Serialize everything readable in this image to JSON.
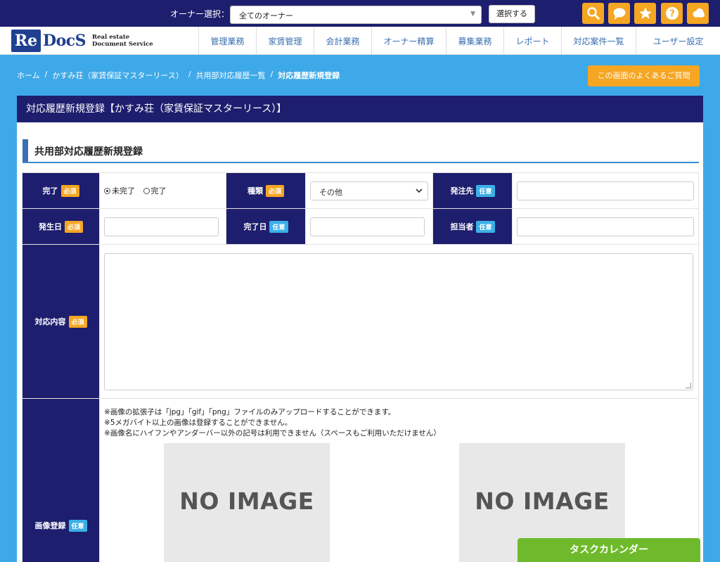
{
  "topbar": {
    "owner_label": "オーナー選択：",
    "owner_value": "全てのオーナー",
    "select_button": "選択する"
  },
  "logo": {
    "re": "Re",
    "docs": "DocS",
    "sub1": "Real estate",
    "sub2": "Document Service"
  },
  "nav": [
    "管理業務",
    "家賃管理",
    "会計業務",
    "オーナー精算",
    "募集業務",
    "レポート",
    "対応案件一覧",
    "ユーザー設定"
  ],
  "breadcrumb": [
    "ホーム",
    "/",
    "かすみ荘（家賃保証マスターリース）",
    "/",
    "共用部対応履歴一覧",
    "/",
    "対応履歴新規登録"
  ],
  "faq_button": "この画面のよくあるご質問",
  "panel_title": "対応履歴新規登録【かすみ荘（家賃保証マスターリース）】",
  "section_title": "共用部対応履歴新規登録",
  "badges": {
    "required": "必須",
    "optional": "任意"
  },
  "form": {
    "completion_label": "完了",
    "radio_incomplete": "未完了",
    "radio_complete": "完了",
    "type_label": "種類",
    "type_value": "その他",
    "orderer_label": "発注先",
    "occurred_label": "発生日",
    "completed_date_label": "完了日",
    "staff_label": "担当者",
    "content_label": "対応内容",
    "image_label": "画像登録",
    "notes": [
      "※画像の拡張子は「jpg」「gif」「png」ファイルのみアップロードすることができます。",
      "※5メガバイト以上の画像は登録することができません。",
      "※画像名にハイフンやアンダーバー以外の記号は利用できません（スペースもご利用いただけません）"
    ],
    "no_image": "NO IMAGE"
  },
  "task_calendar": "タスクカレンダー"
}
